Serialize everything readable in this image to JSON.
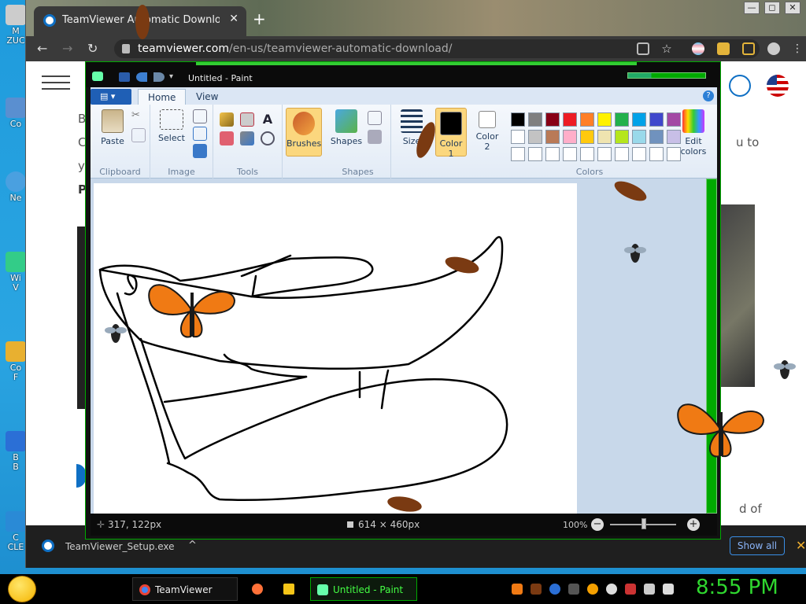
{
  "desktop": {
    "icons": [
      {
        "label": "M\nZUC",
        "color": "#d0d0d0"
      },
      {
        "label": "Co",
        "color": "#5a8fd0"
      },
      {
        "label": "Ne",
        "color": "#4aa0e0"
      },
      {
        "label": "Wi\nV",
        "color": "#3c8"
      },
      {
        "label": "Co\nF",
        "color": "#e8b030"
      },
      {
        "label": "B\nB",
        "color": "#2b6fd6"
      },
      {
        "label": "C\nCLE",
        "color": "#2a8ad6"
      }
    ]
  },
  "browser": {
    "tab_title": "TeamViewer Automatic Download",
    "tab_close": "✕",
    "new_tab": "+",
    "url_host": "teamviewer.com",
    "url_path": "/en-us/teamviewer-automatic-download/",
    "nav": {
      "back": "←",
      "forward": "→",
      "reload": "↻"
    },
    "window_controls": {
      "minimize": "—",
      "maximize": "◻",
      "close": "✕"
    },
    "page_fragments": {
      "left_b": "B",
      "left_c": "C",
      "left_y": "y",
      "left_p": "P",
      "right_uto": "u to",
      "right_dof": "d of"
    }
  },
  "downloads": {
    "file_name": "TeamViewer_Setup.exe",
    "chevron": "^",
    "show_all": "Show all",
    "close": "✕"
  },
  "paint": {
    "title": "Untitled - Paint",
    "tabs": [
      "Home",
      "View"
    ],
    "active_tab": "Home",
    "help": "?",
    "groups": {
      "clipboard": {
        "label": "Clipboard",
        "paste": "Paste"
      },
      "image": {
        "label": "Image",
        "select": "Select"
      },
      "tools": {
        "label": "Tools"
      },
      "brushes": {
        "label": "Brushes"
      },
      "shapes": {
        "label": "Shapes",
        "button": "Shapes"
      },
      "size": {
        "label": "Size"
      },
      "color1": {
        "label": "Color\n1"
      },
      "color2": {
        "label": "Color\n2"
      },
      "colors": {
        "label": "Colors"
      },
      "edit_colors": {
        "label": "Edit\ncolors"
      }
    },
    "palette": [
      [
        "#000000",
        "#7f7f7f",
        "#880015",
        "#ed1c24",
        "#ff7f27",
        "#fff200",
        "#22b14c",
        "#00a2e8",
        "#3f48cc",
        "#a349a4"
      ],
      [
        "#ffffff",
        "#c3c3c3",
        "#b97a57",
        "#ffaec9",
        "#ffc90e",
        "#efe4b0",
        "#b5e61d",
        "#99d9ea",
        "#7092be",
        "#c8bfe7"
      ],
      [
        "#ffffff",
        "#ffffff",
        "#ffffff",
        "#ffffff",
        "#ffffff",
        "#ffffff",
        "#ffffff",
        "#ffffff",
        "#ffffff",
        "#ffffff"
      ]
    ],
    "status": {
      "cursor_pos": "317, 122px",
      "canvas_size": "614 × 460px",
      "zoom": "100%",
      "zoom_out": "−",
      "zoom_in": "+"
    }
  },
  "taskbar": {
    "buttons": [
      {
        "label": "TeamViewer Auto...",
        "color": "#4285f4"
      },
      {
        "label": "",
        "color": "#ff7139"
      },
      {
        "label": "",
        "color": "#f5c518"
      },
      {
        "label": "Untitled - Paint",
        "color": "#6fa"
      }
    ],
    "clock": "8:55 PM"
  }
}
